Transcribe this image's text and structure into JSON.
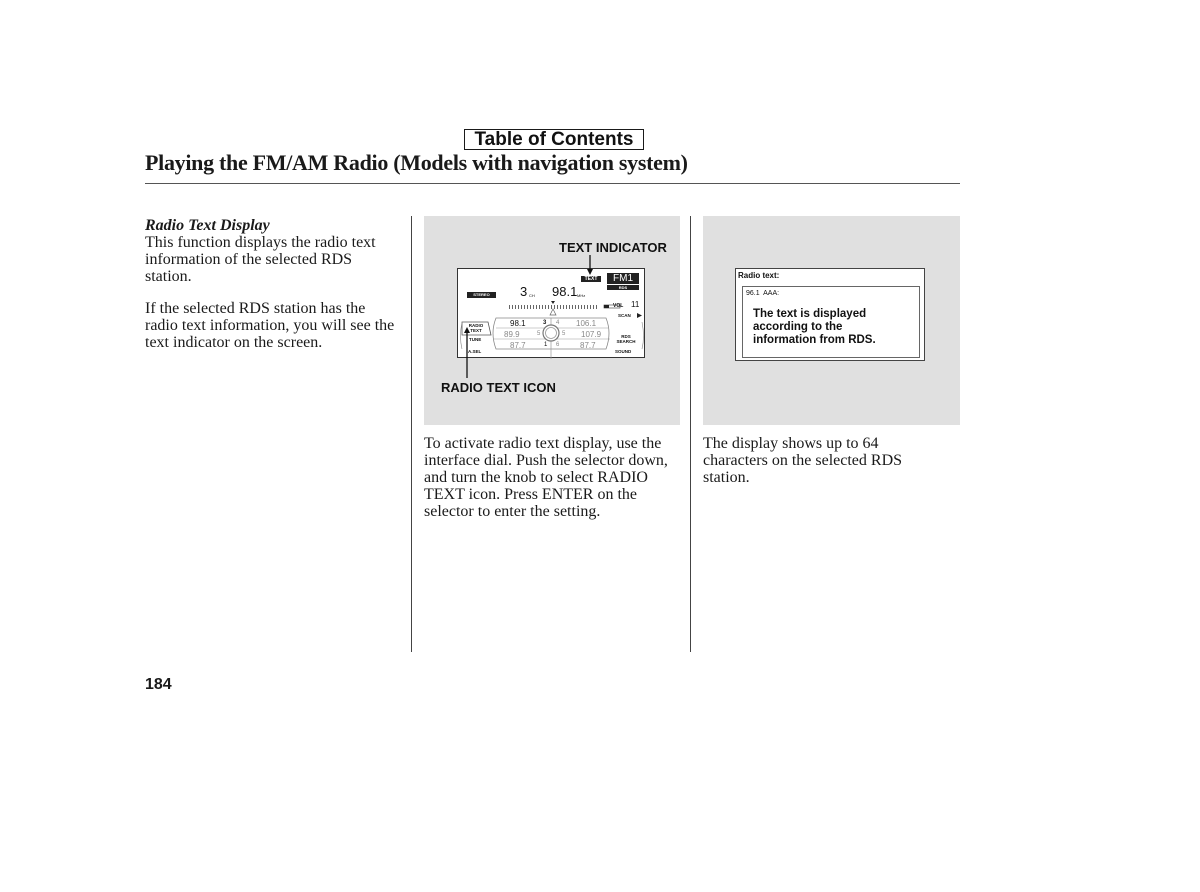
{
  "header": {
    "toc_link": "Table of Contents",
    "title": "Playing the FM/AM Radio (Models with navigation system)"
  },
  "left_column": {
    "heading": "Radio Text Display",
    "paragraphs": [
      "This function displays the radio text information of the selected RDS station.",
      "If the selected RDS station has the radio text information, you will see the text indicator on the screen."
    ]
  },
  "middle_column": {
    "figure": {
      "callouts": {
        "text_indicator": "TEXT INDICATOR",
        "radio_text_icon": "RADIO TEXT ICON"
      },
      "screen": {
        "text_badge": "TEXT",
        "band": "FM1",
        "rds_badge": "RDS",
        "stereo_badge": "STEREO",
        "channel": "3",
        "channel_unit": "CH",
        "frequency": "98.1",
        "frequency_unit": "MHz",
        "volume_label": "VOL",
        "volume_value": "11",
        "scan_label": "SCAN",
        "left_menu": [
          "RADIO TEXT",
          "TUNE",
          "A.SEL"
        ],
        "right_menu": [
          "RDS SEARCH",
          "SOUND"
        ],
        "presets": [
          {
            "num": "3",
            "freq": "98.1",
            "side": "left",
            "selected": true
          },
          {
            "num": "4",
            "freq": "106.1",
            "side": "right",
            "selected": false
          },
          {
            "num": "2",
            "freq": "89.9",
            "side": "left",
            "selected": false
          },
          {
            "num": "5",
            "freq": "107.9",
            "side": "right",
            "selected": false
          },
          {
            "num": "1",
            "freq": "87.7",
            "side": "left",
            "selected": false
          },
          {
            "num": "6",
            "freq": "87.7",
            "side": "right",
            "selected": false
          }
        ]
      }
    },
    "paragraph": "To activate radio text display, use the interface dial. Push the selector down, and turn the knob to select RADIO TEXT icon. Press ENTER on the selector to enter the setting."
  },
  "right_column": {
    "figure": {
      "screen_title": "Radio text:",
      "station_line": "96.1  AAA:",
      "message": [
        "The text is displayed",
        "according to the",
        "information from RDS."
      ]
    },
    "paragraph": "The display shows up to 64 characters on the selected RDS station."
  },
  "footer": {
    "page_number": "184"
  }
}
